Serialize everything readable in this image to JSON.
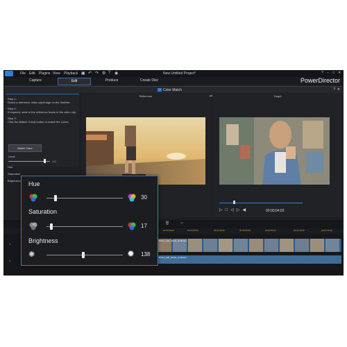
{
  "menu": {
    "items": [
      "File",
      "Edit",
      "Plugins",
      "View",
      "Playback"
    ],
    "window_title": "New Untitled Project*",
    "brand": "PowerDirector"
  },
  "modes": [
    "Capture",
    "Edit",
    "Produce",
    "Create Disc"
  ],
  "color_match": {
    "title": "Color Match",
    "steps": {
      "step1_title": "Step 1:",
      "step1_text": "Select a reference video clip/image on the timeline.",
      "step2_title": "Step 2:",
      "step2_text": "If required, seek to the reference frame in the video clip.",
      "step3_title": "Step 3:",
      "step3_text": "Click the [Match Color] button to match the colors."
    },
    "match_button": "Match Color",
    "level_label": "Level",
    "level_value": "1.0",
    "level_fraction": 0.85,
    "mini_labels": [
      "Hue",
      "Saturation",
      "Brightness"
    ],
    "reference_label": "Reference",
    "target_label": "Target",
    "timecode": "00;00;04;02"
  },
  "adjust_panel": {
    "hue": {
      "label": "Hue",
      "value": "30",
      "fraction": 0.12
    },
    "saturation": {
      "label": "Saturation",
      "value": "17",
      "fraction": 0.06
    },
    "brightness": {
      "label": "Brightness",
      "value": "138",
      "fraction": 0.48
    }
  },
  "timeline": {
    "ticks": [
      "00;00;35;00",
      "00;00;40;00",
      "00;00;45;00",
      "00;00;50;00",
      "00;00;55;00",
      "00;01;00;00",
      "00;01;05;00"
    ],
    "tracks": [
      "1.",
      "1."
    ],
    "clip1_label": "Brown_hair_haired_sunflower",
    "clip2_label": "Brown_hair_haired_sunflower"
  },
  "colors": {
    "accent": "#3f7cc0",
    "timeline_tick": "#d4a43b",
    "clip": "#2a5b8c"
  }
}
